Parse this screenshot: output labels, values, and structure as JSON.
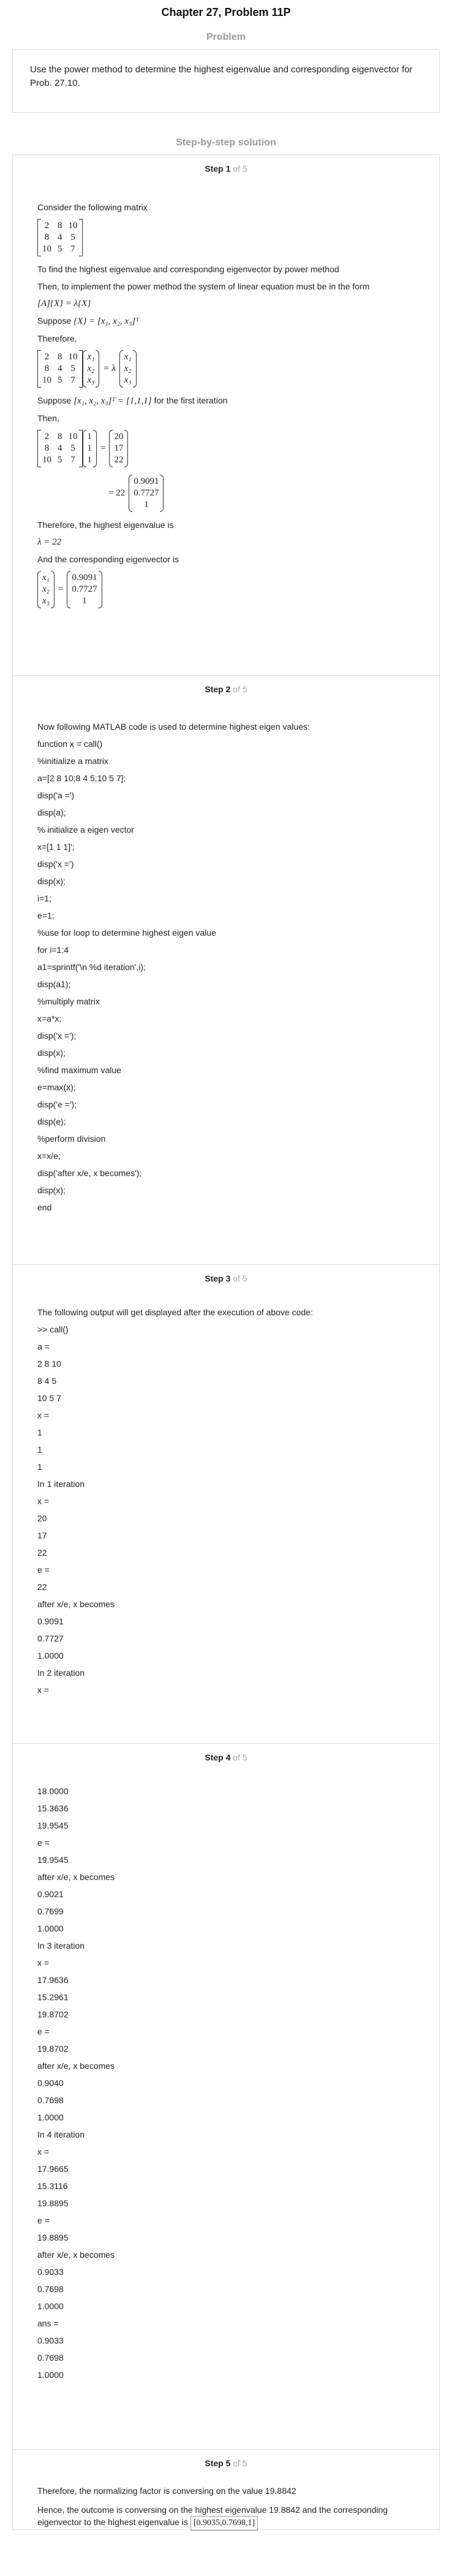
{
  "header": {
    "title": "Chapter 27, Problem 11P",
    "problem_heading": "Problem",
    "solution_heading": "Step-by-step solution"
  },
  "problem": {
    "text": "Use the power method to determine the highest eigenvalue and corresponding eigenvector for Prob. 27.10."
  },
  "steps": {
    "of_label": "of 5",
    "s1": {
      "label": "Step 1",
      "t1": "Consider the following matrix",
      "t2": "To find the highest eigenvalue and corresponding eigenvector by power method",
      "t3": "Then, to implement the power method the system of linear equation must be in the form",
      "eq_form": "[A]{X} = λ{X}",
      "t4": "Suppose",
      "eq_suppose": "{X} = [x₁, x₂, x₃]ᵀ",
      "t5": "Therefore,",
      "t6a": "Suppose",
      "eq_init": "[x₁, x₂, x₃]ᵀ = [1,1,1]",
      "t6b": "for the first iteration",
      "t7": "Then,",
      "t8": "Therefore, the highest eigenvalue is",
      "eq_lambda": "λ = 22",
      "t9": "And the corresponding eigenvector is",
      "eq_times": "= 22"
    },
    "s2": {
      "label": "Step 2",
      "lines": [
        "Now following MATLAB code is used to determine highest eigen values:",
        "function x = call()",
        "%initialize a matrix",
        "a=[2 8 10;8 4 5;10 5 7];",
        "disp('a =')",
        "disp(a);",
        "% initialize a eigen vector",
        "x=[1 1 1]';",
        "disp('x =')",
        "disp(x);",
        "i=1;",
        "e=1;",
        "%use for loop to determine highest eigen value",
        "for i=1:4",
        "a1=sprintf('\\n %d iteration',i);",
        "disp(a1);",
        "%multiply matrix",
        "x=a*x;",
        "disp('x =');",
        "disp(x);",
        "%find maximum value",
        "e=max(x);",
        "disp('e =');",
        "disp(e);",
        "%perform division",
        "x=x/e;",
        "disp('after x/e, x becomes');",
        "disp(x);",
        "end"
      ]
    },
    "s3": {
      "label": "Step 3",
      "lines": [
        "The following output will get displayed after the execution of above code:",
        ">> call()",
        "a =",
        "2 8 10",
        "8 4 5",
        "10 5 7",
        "x =",
        "1",
        "1",
        "1",
        "In 1 iteration",
        "x =",
        "20",
        "17",
        "22",
        "e =",
        "22",
        "after x/e, x becomes",
        "0.9091",
        "0.7727",
        "1.0000",
        "In 2 iteration",
        "x ="
      ]
    },
    "s4": {
      "label": "Step 4",
      "lines": [
        "18.0000",
        "15.3636",
        "19.9545",
        "e =",
        "19.9545",
        "after x/e, x becomes",
        "0.9021",
        "0.7699",
        "1.0000",
        "In 3 iteration",
        "x =",
        "17.9636",
        "15.2961",
        "19.8702",
        "e =",
        "19.8702",
        "after x/e, x becomes",
        "0.9040",
        "0.7698",
        "1.0000",
        "In 4 iteration",
        "x =",
        "17.9665",
        "15.3116",
        "19.8895",
        "e =",
        "19.8895",
        "after x/e, x becomes",
        "0.9033",
        "0.7698",
        "1.0000",
        "ans =",
        "0.9033",
        "0.7698",
        "1.0000"
      ]
    },
    "s5": {
      "label": "Step 5",
      "t1": "Therefore, the normalizing factor is conversing on the value 19.8842",
      "t2": "Hence, the outcome is conversing on the highest eigenvalue 19.8842 and the corresponding eigenvector to the highest eigenvalue is",
      "eq_final": "[0.9035,0.7698,1]"
    }
  },
  "matrices": {
    "A": [
      [
        "2",
        "8",
        "10"
      ],
      [
        "8",
        "4",
        "5"
      ],
      [
        "10",
        "5",
        "7"
      ]
    ],
    "X": [
      "x₁",
      "x₂",
      "x₃"
    ],
    "ones": [
      "1",
      "1",
      "1"
    ],
    "result": [
      "20",
      "17",
      "22"
    ],
    "norm": [
      "0.9091",
      "0.7727",
      "1"
    ],
    "lambda_sym": "= λ",
    "eq": "="
  }
}
